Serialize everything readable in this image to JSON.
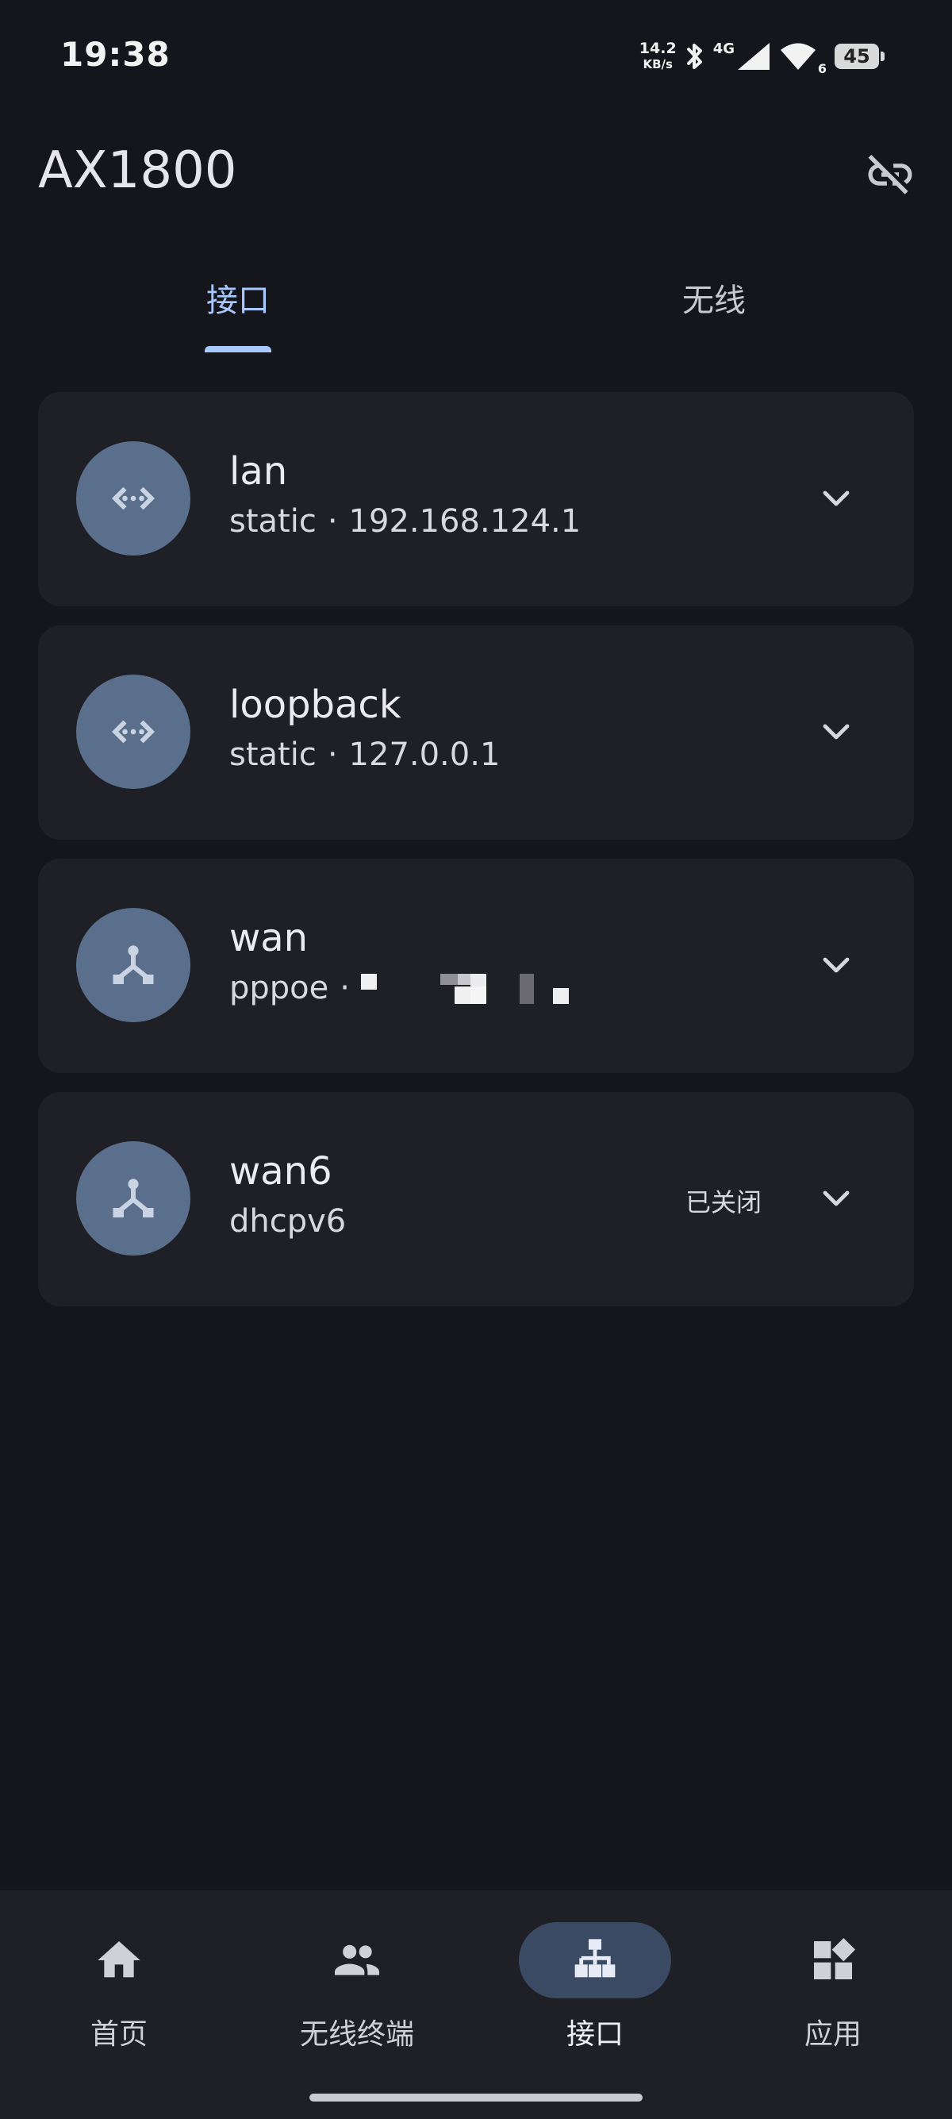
{
  "status_bar": {
    "time": "19:38",
    "net_speed_value": "14.2",
    "net_speed_unit": "KB/s",
    "network_type": "4G",
    "wifi_sub": "6",
    "battery_level": "45",
    "icons": [
      "bluetooth-icon",
      "cell-signal-icon",
      "wifi-icon",
      "battery-icon"
    ]
  },
  "app_bar": {
    "title": "AX1800",
    "action_icon": "link-off-icon"
  },
  "tabs": [
    {
      "label": "接口",
      "active": true
    },
    {
      "label": "无线",
      "active": false
    }
  ],
  "interfaces": [
    {
      "name": "lan",
      "protocol": "static",
      "address": "192.168.124.1",
      "status": "",
      "icon": "ethernet-icon"
    },
    {
      "name": "loopback",
      "protocol": "static",
      "address": "127.0.0.1",
      "status": "",
      "icon": "ethernet-icon"
    },
    {
      "name": "wan",
      "protocol": "pppoe",
      "address": "",
      "address_redacted": true,
      "status": "",
      "icon": "hub-icon"
    },
    {
      "name": "wan6",
      "protocol": "dhcpv6",
      "address": "",
      "status": "已关闭",
      "icon": "hub-icon"
    }
  ],
  "separator": "·",
  "bottom_nav": [
    {
      "label": "首页",
      "icon": "home-icon",
      "active": false
    },
    {
      "label": "无线终端",
      "icon": "people-icon",
      "active": false
    },
    {
      "label": "接口",
      "icon": "lan-icon",
      "active": true
    },
    {
      "label": "应用",
      "icon": "apps-icon",
      "active": false
    }
  ],
  "colors": {
    "background": "#14161b",
    "card": "#1f2025",
    "accent": "#a8c8ff",
    "avatar": "#5a6f8c",
    "nav_active_pill": "#3a4a63"
  }
}
